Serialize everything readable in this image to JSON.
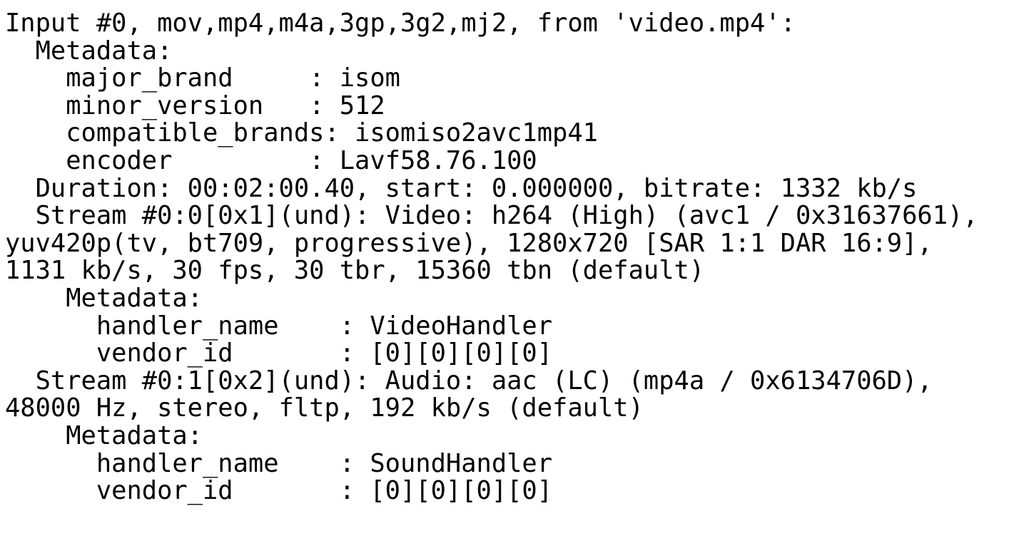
{
  "app": {
    "kind": "terminal-output",
    "program": "ffprobe",
    "background_color": "#ffffff",
    "text_color": "#000000"
  },
  "console": {
    "lines": [
      "Input #0, mov,mp4,m4a,3gp,3g2,mj2, from 'video.mp4':",
      "  Metadata:",
      "    major_brand     : isom",
      "    minor_version   : 512",
      "    compatible_brands: isomiso2avc1mp41",
      "    encoder         : Lavf58.76.100",
      "  Duration: 00:02:00.40, start: 0.000000, bitrate: 1332 kb/s",
      "  Stream #0:0[0x1](und): Video: h264 (High) (avc1 / 0x31637661),",
      "yuv420p(tv, bt709, progressive), 1280x720 [SAR 1:1 DAR 16:9],",
      "1131 kb/s, 30 fps, 30 tbr, 15360 tbn (default)",
      "    Metadata:",
      "      handler_name    : VideoHandler",
      "      vendor_id       : [0][0][0][0]",
      "  Stream #0:1[0x2](und): Audio: aac (LC) (mp4a / 0x6134706D),",
      "48000 Hz, stereo, fltp, 192 kb/s (default)",
      "    Metadata:",
      "      handler_name    : SoundHandler",
      "      vendor_id       : [0][0][0][0]"
    ]
  },
  "parsed": {
    "input_index": "#0",
    "demuxers": "mov,mp4,m4a,3gp,3g2,mj2",
    "filename": "video.mp4",
    "container_metadata": [
      {
        "key": "major_brand",
        "value": "isom"
      },
      {
        "key": "minor_version",
        "value": "512"
      },
      {
        "key": "compatible_brands",
        "value": "isomiso2avc1mp41"
      },
      {
        "key": "encoder",
        "value": "Lavf58.76.100"
      }
    ],
    "duration": "00:02:00.40",
    "start": "0.000000",
    "bitrate": "1332 kb/s",
    "streams": [
      {
        "id": "#0:0[0x1](und)",
        "type": "Video",
        "codec": "h264 (High) (avc1 / 0x31637661)",
        "pixel_format": "yuv420p(tv, bt709, progressive)",
        "resolution": "1280x720",
        "sar": "1:1",
        "dar": "16:9",
        "bitrate": "1131 kb/s",
        "fps": "30 fps",
        "tbr": "30 tbr",
        "tbn": "15360 tbn",
        "disposition": "(default)",
        "metadata": [
          {
            "key": "handler_name",
            "value": "VideoHandler"
          },
          {
            "key": "vendor_id",
            "value": "[0][0][0][0]"
          }
        ]
      },
      {
        "id": "#0:1[0x2](und)",
        "type": "Audio",
        "codec": "aac (LC) (mp4a / 0x6134706D)",
        "sample_rate": "48000 Hz",
        "channels": "stereo",
        "sample_format": "fltp",
        "bitrate": "192 kb/s",
        "disposition": "(default)",
        "metadata": [
          {
            "key": "handler_name",
            "value": "SoundHandler"
          },
          {
            "key": "vendor_id",
            "value": "[0][0][0][0]"
          }
        ]
      }
    ]
  }
}
